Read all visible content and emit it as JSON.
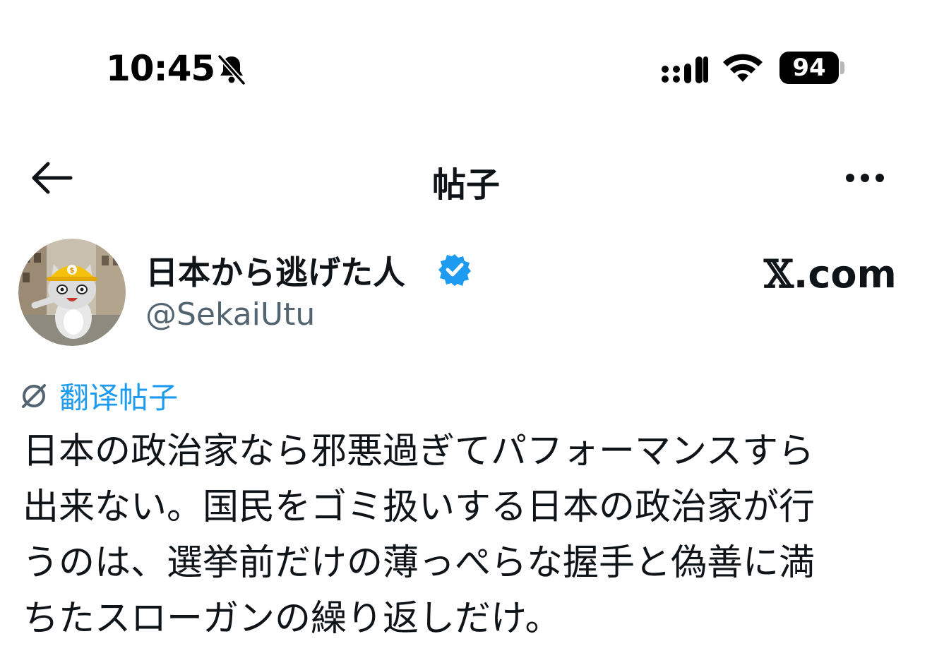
{
  "status_bar": {
    "time": "10:45",
    "battery": "94",
    "icons": [
      "bell-slash-icon",
      "cellular-signal-icon",
      "wifi-icon",
      "battery-icon"
    ]
  },
  "header": {
    "title": "帖子",
    "back_icon": "arrow-left-icon",
    "more_icon": "more-horizontal-icon"
  },
  "post": {
    "author": {
      "display_name": "日本から逃げた人",
      "handle": "@SekaiUtu",
      "verified": true,
      "verified_color": "#1d9bf0"
    },
    "source": {
      "mark": "𝕏",
      "domain": ".com"
    },
    "translate_label": "翻译帖子",
    "text_lines": [
      "日本の政治家なら邪悪過ぎてパフォーマンスすら",
      "出来ない。国民をゴミ扱いする日本の政治家が行",
      "うのは、選挙前だけの薄っぺらな握手と偽善に満",
      "ちたスローガンの繰り返しだけ。"
    ]
  },
  "colors": {
    "text": "#0f1419",
    "secondary": "#536471",
    "accent": "#1d9bf0",
    "background": "#ffffff"
  }
}
